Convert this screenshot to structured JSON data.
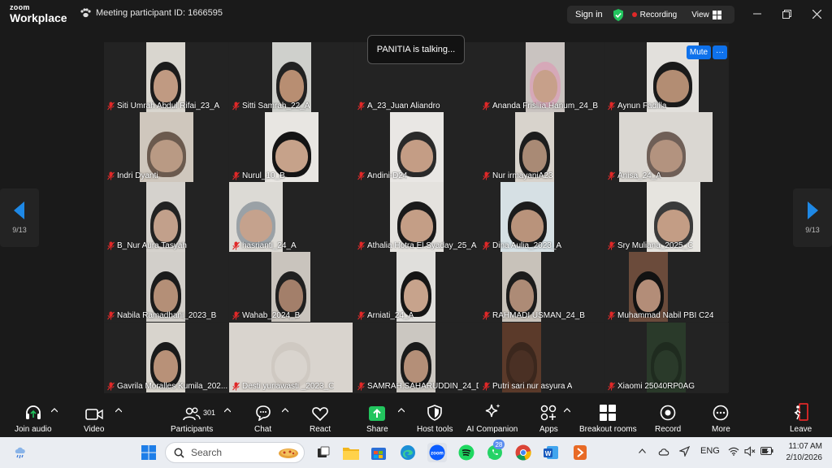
{
  "app": {
    "logo_line1": "zoom",
    "logo_line2": "Workplace",
    "meeting_id_text": "Meeting participant ID: 1666595"
  },
  "top_controls": {
    "sign_in": "Sign in",
    "recording": "Recording",
    "view": "View"
  },
  "talking_indicator": "PANITIA is talking...",
  "active_tile_controls": {
    "mute": "Mute",
    "more": "···"
  },
  "pager": {
    "left": "9/13",
    "right": "9/13"
  },
  "participants": [
    {
      "name": "Siti Umrah Abdul Rifai_23_A"
    },
    {
      "name": "Sitti Samrah_22_A"
    },
    {
      "name": "A_23_Juan Aliandro"
    },
    {
      "name": "Ananda Frisllia Hanum_24_B"
    },
    {
      "name": "Aynun Fadilla"
    },
    {
      "name": "Indri Dyanti"
    },
    {
      "name": "Nurul_10_B"
    },
    {
      "name": "Andini-D24"
    },
    {
      "name": "Nur irmayaniA23"
    },
    {
      "name": "Anisa_24_A"
    },
    {
      "name": "B_Nur Aura Tasyah"
    },
    {
      "name": "hasrianti_24_A"
    },
    {
      "name": "Athalia Hotra El.Syaday_25_A"
    },
    {
      "name": "Dina Aulia_2023_A"
    },
    {
      "name": "Sry Muliana_2025_C"
    },
    {
      "name": "Nabila Ramadhani_2023_B"
    },
    {
      "name": "Wahab_2024_B"
    },
    {
      "name": "Arniati_24_A"
    },
    {
      "name": "RAHMADI USMAN_24_B"
    },
    {
      "name": "Muhammad Nabil PBI C24"
    },
    {
      "name": "Gavrila Moralles Kumila_202..."
    },
    {
      "name": "Desti yuriawasti _2023_C"
    },
    {
      "name": "SAMRAH.SAHARUDDIN_24_D"
    },
    {
      "name": "Putri sari nur asyura A"
    },
    {
      "name": "Xiaomi 25040RP0AG"
    }
  ],
  "toolbar": {
    "join_audio": "Join audio",
    "video": "Video",
    "participants": "Participants",
    "participants_count": "301",
    "chat": "Chat",
    "react": "React",
    "share": "Share",
    "host_tools": "Host tools",
    "ai_companion": "AI Companion",
    "apps": "Apps",
    "breakout_rooms": "Breakout rooms",
    "record": "Record",
    "more": "More",
    "leave": "Leave"
  },
  "taskbar": {
    "search_placeholder": "Search",
    "whatsapp_badge": "28",
    "language": "ENG",
    "time": "11:07 AM",
    "date": "2/10/2026"
  },
  "colors": {
    "accent_blue": "#0e71eb",
    "share_green": "#22c55e",
    "recording_red": "#e02828",
    "leave_red": "#e02828"
  }
}
